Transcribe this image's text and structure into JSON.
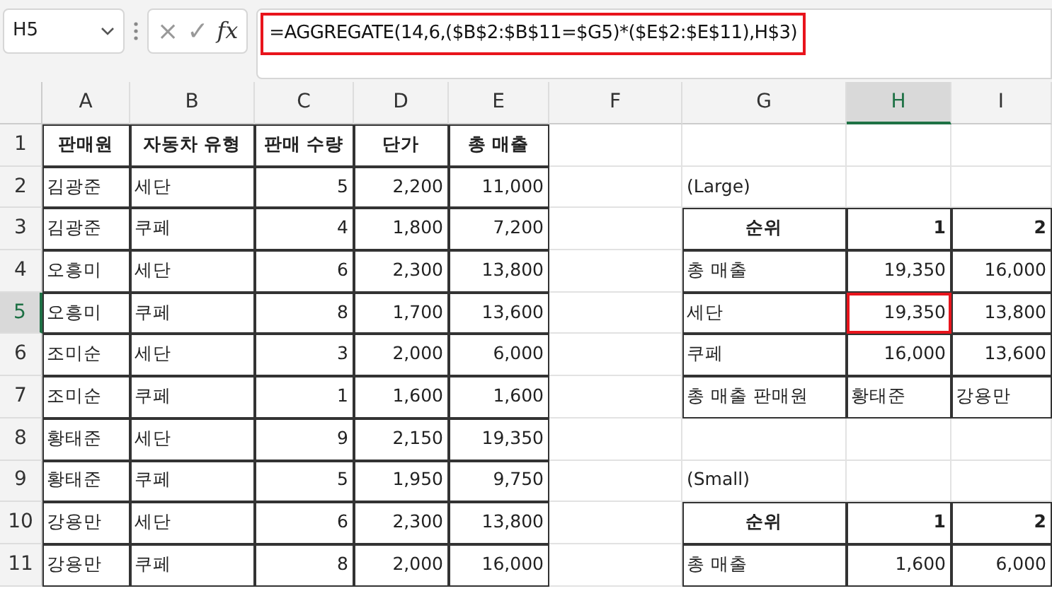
{
  "name_box": {
    "value": "H5"
  },
  "formula_bar": {
    "cancel_icon": "×",
    "enter_icon": "✓",
    "function_label": "fx",
    "formula": "=AGGREGATE(14,6,($B$2:$B$11=$G5)*($E$2:$E$11),H$3)",
    "highlighted": true
  },
  "columns": [
    {
      "label": "A",
      "selected": false
    },
    {
      "label": "B",
      "selected": false
    },
    {
      "label": "C",
      "selected": false
    },
    {
      "label": "D",
      "selected": false
    },
    {
      "label": "E",
      "selected": false
    },
    {
      "label": "F",
      "selected": false
    },
    {
      "label": "G",
      "selected": false
    },
    {
      "label": "H",
      "selected": true
    },
    {
      "label": "I",
      "selected": false
    }
  ],
  "rows": [
    {
      "label": "1",
      "selected": false,
      "cells": [
        {
          "text": "판매원",
          "kind": "header",
          "boxed": true
        },
        {
          "text": "자동차 유형",
          "kind": "header",
          "boxed": true
        },
        {
          "text": "판매 수량",
          "kind": "header",
          "boxed": true
        },
        {
          "text": "단가",
          "kind": "header",
          "boxed": true
        },
        {
          "text": "총 매출",
          "kind": "header",
          "boxed": true
        },
        null,
        null,
        null,
        null
      ]
    },
    {
      "label": "2",
      "selected": false,
      "cells": [
        {
          "text": "김광준",
          "kind": "text",
          "boxed": true
        },
        {
          "text": "세단",
          "kind": "text",
          "boxed": true
        },
        {
          "text": "5",
          "kind": "number",
          "boxed": true
        },
        {
          "text": "2,200",
          "kind": "number",
          "boxed": true
        },
        {
          "text": "11,000",
          "kind": "number",
          "boxed": true
        },
        null,
        {
          "text": "(Large)",
          "kind": "text",
          "boxed": false
        },
        null,
        null
      ]
    },
    {
      "label": "3",
      "selected": false,
      "cells": [
        {
          "text": "김광준",
          "kind": "text",
          "boxed": true
        },
        {
          "text": "쿠페",
          "kind": "text",
          "boxed": true
        },
        {
          "text": "4",
          "kind": "number",
          "boxed": true
        },
        {
          "text": "1,800",
          "kind": "number",
          "boxed": true
        },
        {
          "text": "7,200",
          "kind": "number",
          "boxed": true
        },
        null,
        {
          "text": "순위",
          "kind": "header",
          "boxed": true
        },
        {
          "text": "1",
          "kind": "header-number",
          "boxed": true
        },
        {
          "text": "2",
          "kind": "header-number",
          "boxed": true
        }
      ]
    },
    {
      "label": "4",
      "selected": false,
      "cells": [
        {
          "text": "오흥미",
          "kind": "text",
          "boxed": true
        },
        {
          "text": "세단",
          "kind": "text",
          "boxed": true
        },
        {
          "text": "6",
          "kind": "number",
          "boxed": true
        },
        {
          "text": "2,300",
          "kind": "number",
          "boxed": true
        },
        {
          "text": "13,800",
          "kind": "number",
          "boxed": true
        },
        null,
        {
          "text": "총 매출",
          "kind": "text",
          "boxed": true
        },
        {
          "text": "19,350",
          "kind": "number",
          "boxed": true
        },
        {
          "text": "16,000",
          "kind": "number",
          "boxed": true
        }
      ]
    },
    {
      "label": "5",
      "selected": true,
      "cells": [
        {
          "text": "오흥미",
          "kind": "text",
          "boxed": true
        },
        {
          "text": "쿠페",
          "kind": "text",
          "boxed": true
        },
        {
          "text": "8",
          "kind": "number",
          "boxed": true
        },
        {
          "text": "1,700",
          "kind": "number",
          "boxed": true
        },
        {
          "text": "13,600",
          "kind": "number",
          "boxed": true
        },
        null,
        {
          "text": "세단",
          "kind": "text",
          "boxed": true
        },
        {
          "text": "19,350",
          "kind": "number",
          "boxed": true,
          "selected": true
        },
        {
          "text": "13,800",
          "kind": "number",
          "boxed": true
        }
      ]
    },
    {
      "label": "6",
      "selected": false,
      "cells": [
        {
          "text": "조미순",
          "kind": "text",
          "boxed": true
        },
        {
          "text": "세단",
          "kind": "text",
          "boxed": true
        },
        {
          "text": "3",
          "kind": "number",
          "boxed": true
        },
        {
          "text": "2,000",
          "kind": "number",
          "boxed": true
        },
        {
          "text": "6,000",
          "kind": "number",
          "boxed": true
        },
        null,
        {
          "text": "쿠페",
          "kind": "text",
          "boxed": true
        },
        {
          "text": "16,000",
          "kind": "number",
          "boxed": true
        },
        {
          "text": "13,600",
          "kind": "number",
          "boxed": true
        }
      ]
    },
    {
      "label": "7",
      "selected": false,
      "cells": [
        {
          "text": "조미순",
          "kind": "text",
          "boxed": true
        },
        {
          "text": "쿠페",
          "kind": "text",
          "boxed": true
        },
        {
          "text": "1",
          "kind": "number",
          "boxed": true
        },
        {
          "text": "1,600",
          "kind": "number",
          "boxed": true
        },
        {
          "text": "1,600",
          "kind": "number",
          "boxed": true
        },
        null,
        {
          "text": "총 매출 판매원",
          "kind": "text",
          "boxed": true
        },
        {
          "text": "황태준",
          "kind": "text",
          "boxed": true
        },
        {
          "text": "강용만",
          "kind": "text",
          "boxed": true
        }
      ]
    },
    {
      "label": "8",
      "selected": false,
      "cells": [
        {
          "text": "황태준",
          "kind": "text",
          "boxed": true
        },
        {
          "text": "세단",
          "kind": "text",
          "boxed": true
        },
        {
          "text": "9",
          "kind": "number",
          "boxed": true
        },
        {
          "text": "2,150",
          "kind": "number",
          "boxed": true
        },
        {
          "text": "19,350",
          "kind": "number",
          "boxed": true
        },
        null,
        null,
        null,
        null
      ]
    },
    {
      "label": "9",
      "selected": false,
      "cells": [
        {
          "text": "황태준",
          "kind": "text",
          "boxed": true
        },
        {
          "text": "쿠페",
          "kind": "text",
          "boxed": true
        },
        {
          "text": "5",
          "kind": "number",
          "boxed": true
        },
        {
          "text": "1,950",
          "kind": "number",
          "boxed": true
        },
        {
          "text": "9,750",
          "kind": "number",
          "boxed": true
        },
        null,
        {
          "text": "(Small)",
          "kind": "text",
          "boxed": false
        },
        null,
        null
      ]
    },
    {
      "label": "10",
      "selected": false,
      "cells": [
        {
          "text": "강용만",
          "kind": "text",
          "boxed": true
        },
        {
          "text": "세단",
          "kind": "text",
          "boxed": true
        },
        {
          "text": "6",
          "kind": "number",
          "boxed": true
        },
        {
          "text": "2,300",
          "kind": "number",
          "boxed": true
        },
        {
          "text": "13,800",
          "kind": "number",
          "boxed": true
        },
        null,
        {
          "text": "순위",
          "kind": "header",
          "boxed": true
        },
        {
          "text": "1",
          "kind": "header-number",
          "boxed": true
        },
        {
          "text": "2",
          "kind": "header-number",
          "boxed": true
        }
      ]
    },
    {
      "label": "11",
      "selected": false,
      "cells": [
        {
          "text": "강용만",
          "kind": "text",
          "boxed": true
        },
        {
          "text": "쿠페",
          "kind": "text",
          "boxed": true
        },
        {
          "text": "8",
          "kind": "number",
          "boxed": true
        },
        {
          "text": "2,000",
          "kind": "number",
          "boxed": true
        },
        {
          "text": "16,000",
          "kind": "number",
          "boxed": true
        },
        null,
        {
          "text": "총 매출",
          "kind": "text",
          "boxed": true
        },
        {
          "text": "1,600",
          "kind": "number",
          "boxed": true
        },
        {
          "text": "6,000",
          "kind": "number",
          "boxed": true
        }
      ]
    }
  ]
}
